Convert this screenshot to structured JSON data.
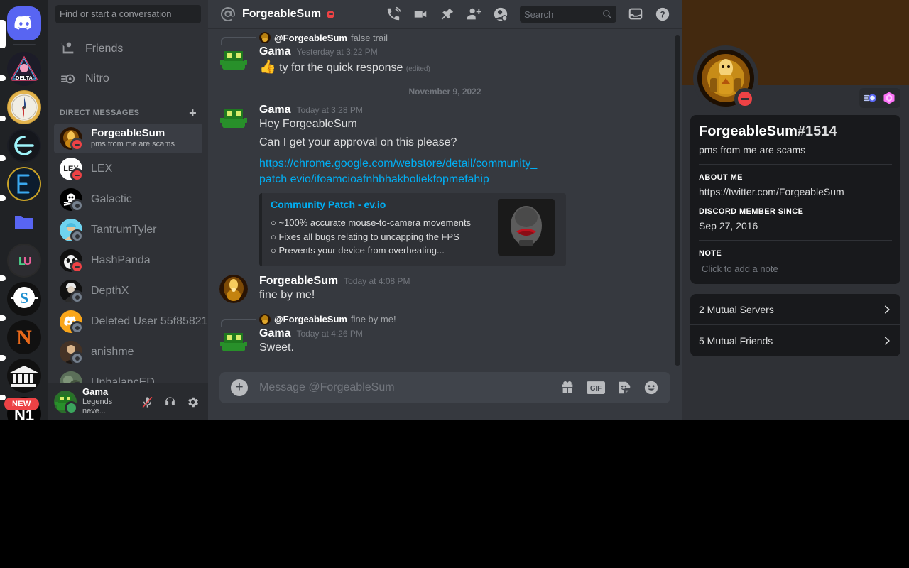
{
  "rail": {
    "home_label": "Discord",
    "new_badge": "NEW",
    "servers": [
      {
        "name": "DELTA",
        "short": "DELTA"
      },
      {
        "name": "Compass",
        "short": ""
      },
      {
        "name": "Epsilon",
        "short": "e"
      },
      {
        "name": "E Server",
        "short": "E"
      },
      {
        "name": "Folder",
        "short": ""
      },
      {
        "name": "LU",
        "short": "LU"
      },
      {
        "name": "S Server",
        "short": "S"
      },
      {
        "name": "N Server",
        "short": "N"
      },
      {
        "name": "Bank",
        "short": ""
      },
      {
        "name": "N1",
        "short": "N1"
      }
    ]
  },
  "sidebar": {
    "search_placeholder": "Find or start a conversation",
    "nav": [
      {
        "label": "Friends",
        "icon": "friends-icon"
      },
      {
        "label": "Nitro",
        "icon": "nitro-icon"
      }
    ],
    "dm_header": "DIRECT MESSAGES",
    "add_dm": "+",
    "dms": [
      {
        "name": "ForgeableSum",
        "sub": "pms from me are scams",
        "status": "dnd",
        "active": true,
        "avatar_type": "forge"
      },
      {
        "name": "LEX",
        "status": "dnd",
        "active": false,
        "avatar_type": "lex"
      },
      {
        "name": "Galactic",
        "status": "offline",
        "active": false,
        "avatar_type": "skull"
      },
      {
        "name": "TantrumTyler",
        "status": "offline",
        "active": false,
        "avatar_type": "tyler"
      },
      {
        "name": "HashPanda",
        "status": "dnd",
        "active": false,
        "avatar_type": "panda"
      },
      {
        "name": "DepthX",
        "status": "offline",
        "active": false,
        "avatar_type": "depth"
      },
      {
        "name": "Deleted User 55f85821",
        "status": "offline",
        "active": false,
        "avatar_type": "deleted"
      },
      {
        "name": "anishme",
        "status": "offline",
        "active": false,
        "avatar_type": "anish"
      },
      {
        "name": "UnbalancED",
        "status": "dnd",
        "active": false,
        "avatar_type": "unbal"
      }
    ],
    "me": {
      "name": "Gama",
      "sub": "Legends neve...",
      "status": "online",
      "icons": [
        "mic-muted-icon",
        "headset-icon",
        "settings-gear-icon"
      ]
    }
  },
  "header": {
    "at_icon": "at-sign-icon",
    "title": "ForgeableSum",
    "status": "dnd",
    "icons": [
      "voice-call-icon",
      "video-call-icon",
      "pin-icon",
      "add-friend-icon",
      "user-profile-icon"
    ],
    "search_placeholder": "Search",
    "right_icons": [
      "inbox-icon",
      "help-icon"
    ]
  },
  "chat": {
    "reply_top": {
      "author": "@ForgeableSum",
      "text": "false trail"
    },
    "messages": [
      {
        "author": "Gama",
        "time": "Yesterday at 3:22 PM",
        "lines": [
          "ty for the quick response"
        ],
        "emoji": "👍",
        "edited": "(edited)"
      }
    ],
    "date_divider": "November 9, 2022",
    "message2": {
      "author": "Gama",
      "time": "Today at 3:28 PM",
      "line1": "Hey ForgeableSum",
      "line2": "Can I get your approval on this please?",
      "link_line1": "https://chrome.google.com/webstore/detail/community_patch",
      "link_line2": "evio/ifoamcioafnhbhakboliekfopmefahip",
      "embed": {
        "title": "Community Patch - ev.io",
        "desc_lines": [
          "○ ~100% accurate mouse-to-camera movements",
          "○ Fixes all bugs relating to uncapping the FPS",
          "○ Prevents your device from overheating..."
        ]
      }
    },
    "message3": {
      "author": "ForgeableSum",
      "time": "Today at 4:08 PM",
      "text": "fine by me!"
    },
    "reply_bottom": {
      "author": "@ForgeableSum",
      "text": "fine by me!"
    },
    "message4": {
      "author": "Gama",
      "time": "Today at 4:26 PM",
      "text": "Sweet."
    },
    "composer": {
      "placeholder": "Message @ForgeableSum",
      "plus": "+",
      "gif_label": "GIF",
      "tools": [
        "gift-icon",
        "gif-icon",
        "sticker-icon",
        "emoji-icon"
      ]
    }
  },
  "profile": {
    "username": "ForgeableSum",
    "discriminator": "#1514",
    "custom_status": "pms from me are scams",
    "status": "dnd",
    "badges": [
      "nitro-badge-icon",
      "boost-badge-icon"
    ],
    "about_label": "ABOUT ME",
    "about_value": "https://twitter.com/ForgeableSum",
    "member_since_label": "DISCORD MEMBER SINCE",
    "member_since_value": "Sep 27, 2016",
    "note_label": "NOTE",
    "note_placeholder": "Click to add a note",
    "mutuals": [
      {
        "label": "2 Mutual Servers"
      },
      {
        "label": "5 Mutual Friends"
      }
    ]
  },
  "colors": {
    "brand": "#5865f2",
    "link": "#00aff4",
    "dnd": "#ed4245",
    "online": "#3ba55d",
    "offline": "#747f8d",
    "banner": "#43290f"
  }
}
